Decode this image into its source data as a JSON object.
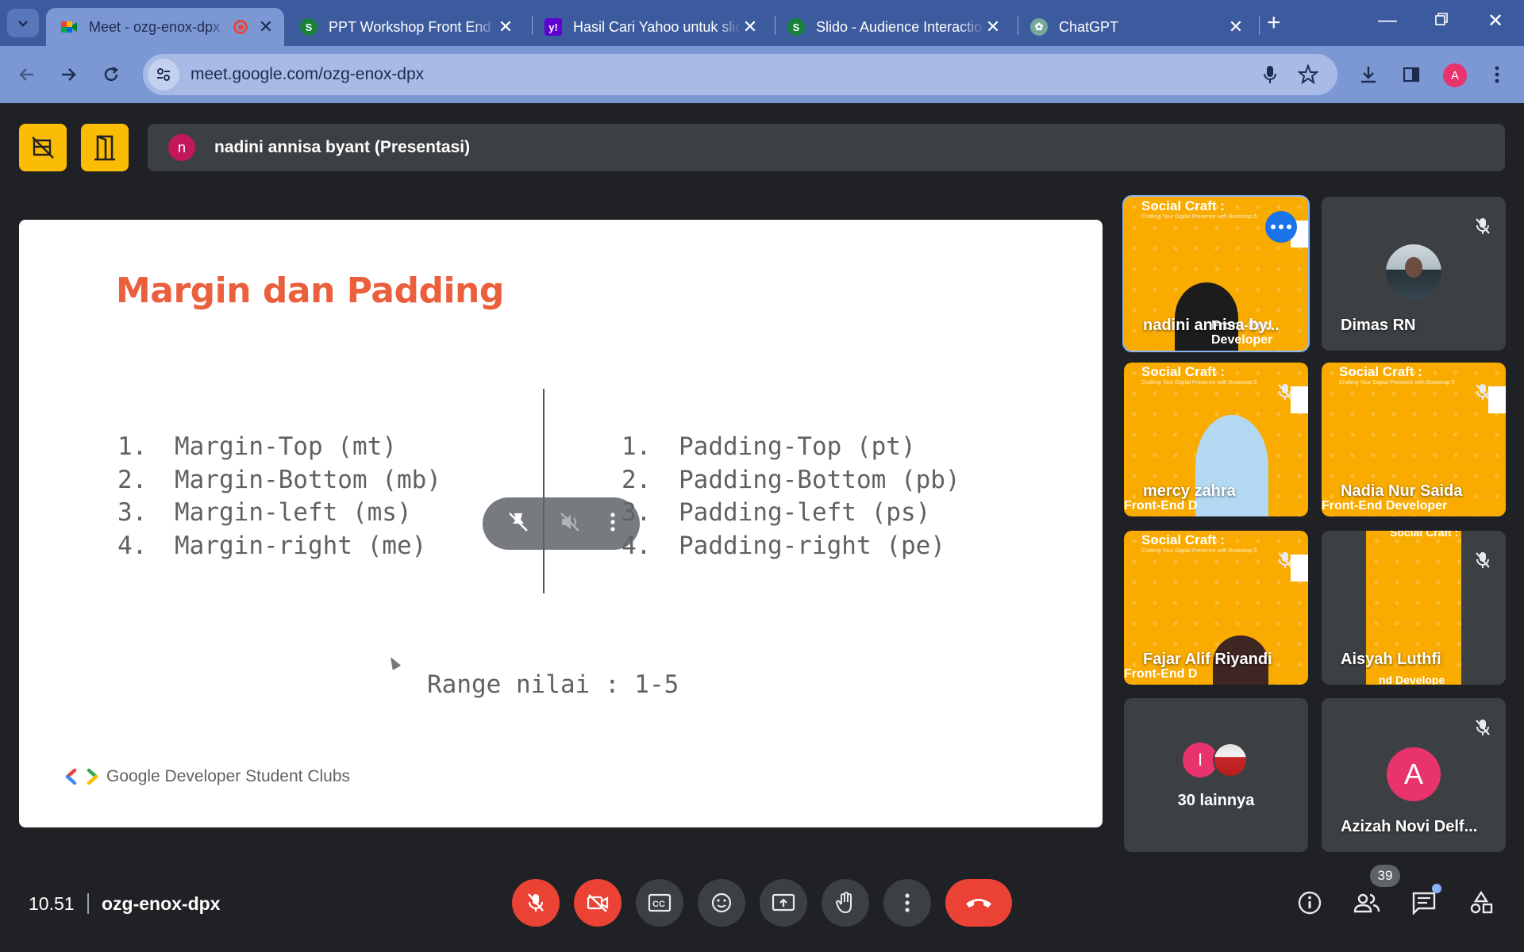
{
  "browser": {
    "tabs": [
      {
        "title": "Meet - ozg-enox-dpx",
        "favicon": "meet-icon",
        "recording": true,
        "active": true
      },
      {
        "title": "PPT Workshop Front End",
        "favicon": "slides-icon",
        "active": false
      },
      {
        "title": "Hasil Cari Yahoo untuk slido",
        "favicon": "yahoo-icon",
        "active": false
      },
      {
        "title": "Slido - Audience Interaction",
        "favicon": "slido-icon",
        "active": false
      },
      {
        "title": "ChatGPT",
        "favicon": "chatgpt-icon",
        "active": false
      }
    ],
    "url": "meet.google.com/ozg-enox-dpx",
    "profile_initial": "A"
  },
  "meet": {
    "presenter_initial": "n",
    "presenter_label": "nadini annisa byant (Presentasi)",
    "slide": {
      "title": "Margin dan Padding",
      "margin_items": [
        {
          "num": "1.",
          "text": "Margin-Top (mt)"
        },
        {
          "num": "2.",
          "text": "Margin-Bottom (mb)"
        },
        {
          "num": "3.",
          "text": "Margin-left (ms)"
        },
        {
          "num": "4.",
          "text": "Margin-right (me)"
        }
      ],
      "padding_items": [
        {
          "num": "1.",
          "text": "Padding-Top (pt)"
        },
        {
          "num": "2.",
          "text": "Padding-Bottom (pb)"
        },
        {
          "num": "3.",
          "text": "Padding-left (ps)"
        },
        {
          "num": "4.",
          "text": "Padding-right (pe)"
        }
      ],
      "range": "Range nilai : 1-5",
      "footer": "Google Developer Student Clubs"
    },
    "tiles": {
      "t1": {
        "name": "nadini annisa by...",
        "share_title": "Social Craft :",
        "share_sub": "Crafting Your Digital Presence with Bootstrap 5",
        "footer": "Front-End Developer"
      },
      "t2": {
        "name": "Dimas RN"
      },
      "t3": {
        "name": "mercy zahra",
        "share_title": "Social Craft :",
        "share_sub": "Crafting Your Digital Presence with Bootstrap 5",
        "footer": "Front-End D"
      },
      "t4": {
        "name": "Nadia Nur Saida",
        "share_title": "Social Craft :",
        "share_sub": "Crafting Your Digital Presence with Bootstrap 5",
        "footer": "Front-End Developer"
      },
      "t5": {
        "name": "Fajar Alif Riyandi",
        "share_title": "Social Craft :",
        "share_sub": "Crafting Your Digital Presence with Bootstrap 5",
        "footer": "Front-End D"
      },
      "t6": {
        "name": "Aisyah Luthfi",
        "share_title": "Social Craft :",
        "footer": "nd Develope"
      },
      "t7": {
        "others_initial": "I",
        "label": "30 lainnya"
      },
      "t8": {
        "name": "Azizah Novi Delf...",
        "initial": "A"
      }
    },
    "bottom": {
      "time": "10.51",
      "meeting_code": "ozg-enox-dpx",
      "participant_count": "39"
    }
  },
  "colors": {
    "tabstrip": "#3c5b9e",
    "toolbar": "#7b97d4",
    "meet_bg": "#202124",
    "accent_yellow": "#fbbc04",
    "danger_red": "#ea4335",
    "slide_title": "#ea5f3c"
  }
}
